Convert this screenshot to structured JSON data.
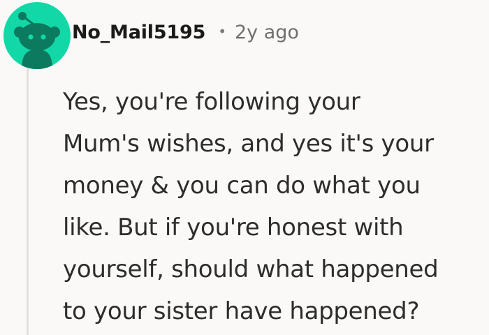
{
  "comment": {
    "avatar_icon": "reddit-snoo-avatar-icon",
    "avatar_color": "#12d8a7",
    "username": "No_Mail5195",
    "separator": "•",
    "timestamp": "2y ago",
    "body_lines": [
      "Yes, you're following your",
      "Mum's wishes, and yes it's your",
      "money & you can do what you",
      "like. But if you're honest with",
      "yourself, should what happened",
      "to your sister have happened?"
    ]
  }
}
